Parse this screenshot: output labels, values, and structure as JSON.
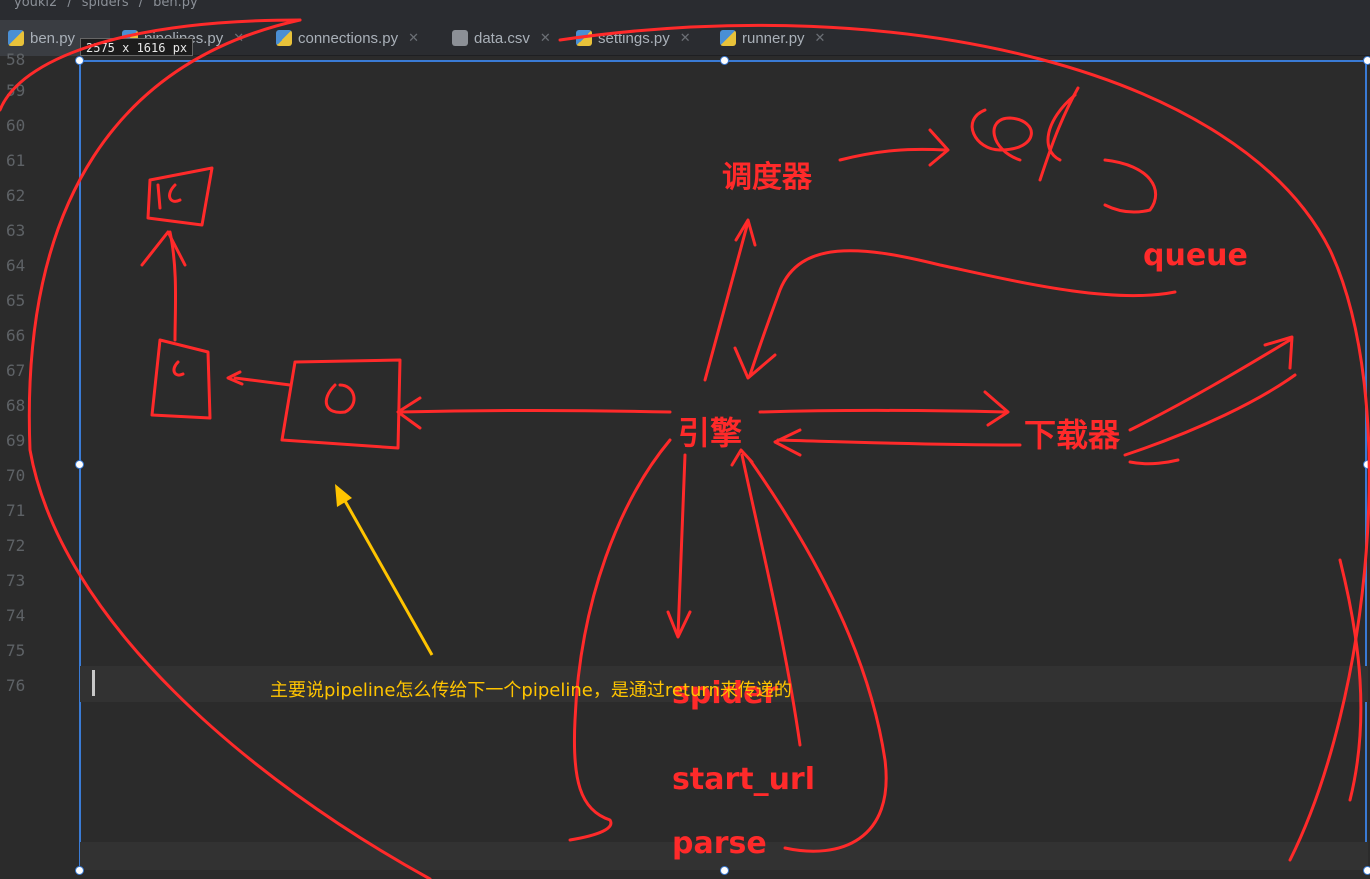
{
  "breadcrumb": [
    "youki2",
    "spiders",
    "ben.py"
  ],
  "tabs": [
    {
      "label": "ben.py",
      "active": true,
      "icon": "python-file-icon"
    },
    {
      "label": "pipelines.py",
      "active": false,
      "icon": "python-file-icon"
    },
    {
      "label": "connections.py",
      "active": false,
      "icon": "python-file-icon"
    },
    {
      "label": "data.csv",
      "active": false,
      "icon": "csv-file-icon"
    },
    {
      "label": "settings.py",
      "active": false,
      "icon": "python-file-icon"
    },
    {
      "label": "runner.py",
      "active": false,
      "icon": "python-file-icon"
    }
  ],
  "screenshot_size_badge": "2575 x 1616  px",
  "line_numbers": [
    "58",
    "59",
    "60",
    "61",
    "62",
    "63",
    "64",
    "65",
    "66",
    "67",
    "68",
    "69",
    "70",
    "71",
    "72",
    "73",
    "74",
    "75",
    "76"
  ],
  "diagram": {
    "scheduler": "调度器",
    "queue": "queue",
    "engine": "引擎",
    "downloader": "下载器",
    "spider": "spider",
    "start_url": "start_url",
    "parse": "parse"
  },
  "annotation": "主要说pipeline怎么传给下一个pipeline，是通过return来传递的",
  "colors": {
    "ink": "#ff2a2a",
    "annotation": "#ffc400",
    "arrow": "#ffc400",
    "selection": "#3a7bd5",
    "editor_bg": "#2b2b2b"
  }
}
